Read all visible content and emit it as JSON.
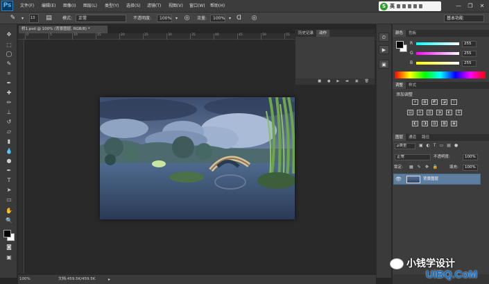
{
  "app": {
    "logo": "Ps"
  },
  "menu": [
    "文件(F)",
    "编辑(E)",
    "图像(I)",
    "图层(L)",
    "类型(Y)",
    "选择(S)",
    "滤镜(T)",
    "视图(V)",
    "窗口(W)",
    "帮助(H)"
  ],
  "ime": {
    "label": "英"
  },
  "window_controls": {
    "minimize": "—",
    "restore": "❐",
    "close": "✕"
  },
  "options": {
    "brush_size": "13",
    "mode_label": "模式:",
    "mode_value": "正常",
    "opacity_label": "不透明度:",
    "opacity_value": "100%",
    "flow_label": "流量:",
    "flow_value": "100%",
    "workspace": "基本功能"
  },
  "document": {
    "tab_title": "桥1.psd @ 100% (背景图层, RGB/8) *",
    "zoom": "100%",
    "doc_size": "文档:459.5K/459.5K",
    "ruler_labels": [
      "0",
      "5",
      "10",
      "15",
      "20",
      "25",
      "30",
      "35",
      "40",
      "45",
      "50",
      "55",
      "60",
      "65",
      "70"
    ]
  },
  "history_panel": {
    "tabs": [
      "历史记录",
      "动作"
    ]
  },
  "color_panel": {
    "tabs": [
      "颜色",
      "色板"
    ],
    "channels": [
      {
        "label": "R",
        "value": "255",
        "color": "#ff3b3b"
      },
      {
        "label": "G",
        "value": "255",
        "color": "#3bff3b"
      },
      {
        "label": "B",
        "value": "255",
        "color": "#3b6bff"
      }
    ]
  },
  "adjustments_panel": {
    "tabs": [
      "调整",
      "样式"
    ],
    "title": "添加调整",
    "row1": [
      "☀",
      "▦",
      "◩",
      "◪",
      "▽"
    ],
    "row2": [
      "▤",
      "⚖",
      "▥",
      "◑",
      "◐",
      "⊞"
    ],
    "row3": [
      "◧",
      "◨",
      "▨",
      "▩",
      "▣"
    ]
  },
  "layers_panel": {
    "tabs": [
      "图层",
      "通道",
      "路径"
    ],
    "kind_label": "ρ类型",
    "blend_mode": "正常",
    "opacity_label": "不透明度:",
    "opacity_value": "100%",
    "lock_label": "锁定:",
    "fill_label": "填充:",
    "fill_value": "100%",
    "layer_name": "背景图层"
  },
  "watermark": {
    "text": "小钱学设计",
    "url": "UiBQ.CoM"
  }
}
